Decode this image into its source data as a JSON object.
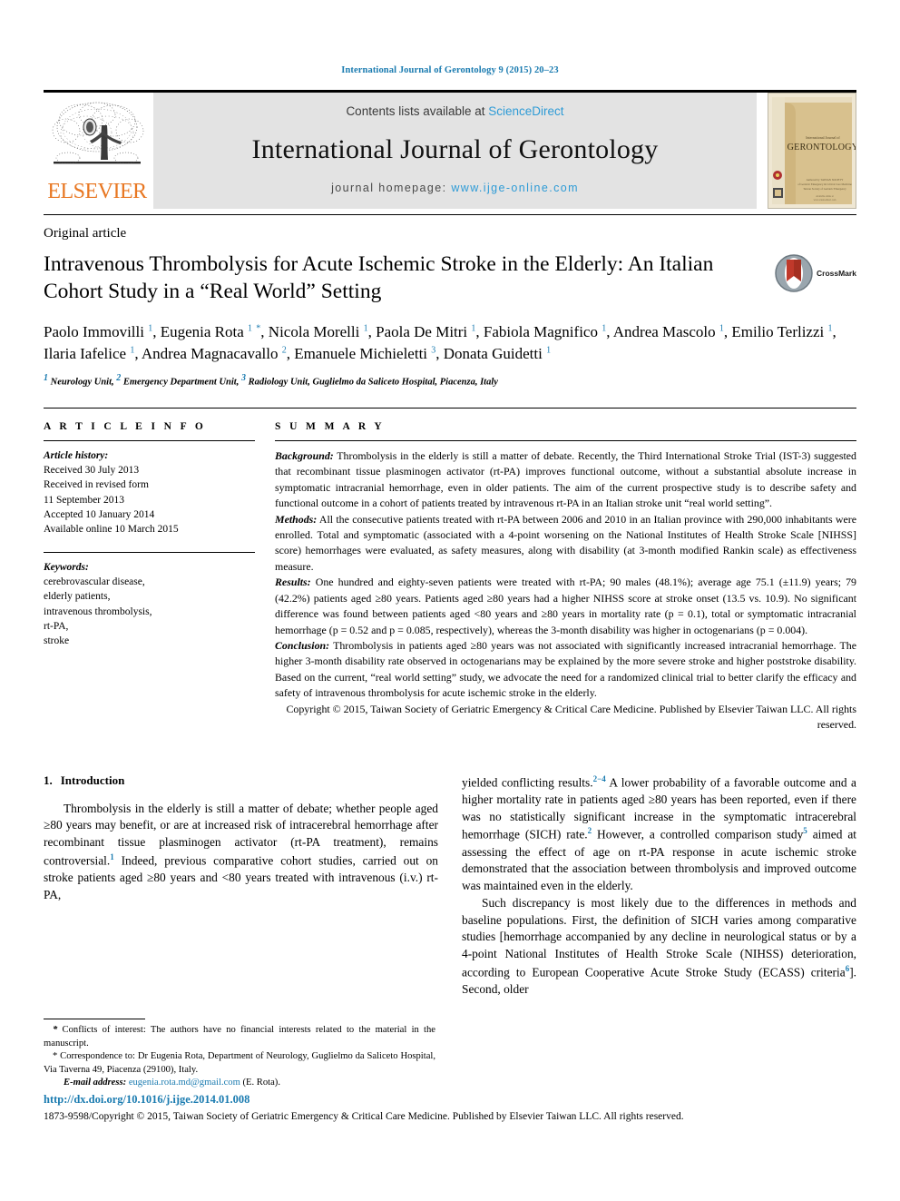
{
  "running_head": "International Journal of Gerontology 9 (2015) 20–23",
  "masthead": {
    "publisher_logo_text": "ELSEVIER",
    "contents_prefix": "Contents lists available at ",
    "contents_link": "ScienceDirect",
    "journal_title": "International Journal of Gerontology",
    "homepage_prefix": "journal homepage: ",
    "homepage_url": "www.ijge-online.com",
    "cover": {
      "small_title": "International Journal of",
      "big_title": "GERONTOLOGY",
      "publisher_note": "Published by ELSEVIER TAIWAN LLC",
      "society_note": "Taiwan Society of Geriatric Emergency & Critical Care Medicine",
      "footer_note": "Available online at",
      "footer_note2": "www.sciencedirect.com"
    }
  },
  "article": {
    "type": "Original article",
    "title": "Intravenous Thrombolysis for Acute Ischemic Stroke in the Elderly: An Italian Cohort Study in a “Real World” Setting",
    "title_footnote_marker": "★",
    "crossmark_label": "CrossMark",
    "authors_html": "Paolo Immovilli <sup>1</sup>, Eugenia Rota <sup>1</sup> <sup class=\"star\">*</sup>, Nicola Morelli <sup>1</sup>, Paola De Mitri <sup>1</sup>, Fabiola Magnifico <sup>1</sup>, Andrea Mascolo <sup>1</sup>, Emilio Terlizzi <sup>1</sup>, Ilaria Iafelice <sup>1</sup>, Andrea Magnacavallo <sup>2</sup>, Emanuele Michieletti <sup>3</sup>, Donata Guidetti <sup>1</sup>",
    "affiliations_html": "<sup>1</sup> Neurology Unit, <sup>2</sup> Emergency Department Unit, <sup>3</sup> Radiology Unit, Guglielmo da Saliceto Hospital, Piacenza, Italy"
  },
  "article_info": {
    "heading": "A R T I C L E  I N F O",
    "history_label": "Article history:",
    "history": [
      "Received 30 July 2013",
      "Received in revised form",
      "11 September 2013",
      "Accepted 10 January 2014",
      "Available online 10 March 2015"
    ],
    "keywords_label": "Keywords:",
    "keywords": [
      "cerebrovascular disease,",
      "elderly patients,",
      "intravenous thrombolysis,",
      "rt-PA,",
      "stroke"
    ]
  },
  "summary": {
    "heading": "S U M M A R Y",
    "background_label": "Background:",
    "background_text": " Thrombolysis in the elderly is still a matter of debate. Recently, the Third International Stroke Trial (IST-3) suggested that recombinant tissue plasminogen activator (rt-PA) improves functional outcome, without a substantial absolute increase in symptomatic intracranial hemorrhage, even in older patients. The aim of the current prospective study is to describe safety and functional outcome in a cohort of patients treated by intravenous rt-PA in an Italian stroke unit “real world setting”.",
    "methods_label": "Methods:",
    "methods_text": " All the consecutive patients treated with rt-PA between 2006 and 2010 in an Italian province with 290,000 inhabitants were enrolled. Total and symptomatic (associated with a 4-point worsening on the National Institutes of Health Stroke Scale [NIHSS] score) hemorrhages were evaluated, as safety measures, along with disability (at 3-month modified Rankin scale) as effectiveness measure.",
    "results_label": "Results:",
    "results_text": " One hundred and eighty-seven patients were treated with rt-PA; 90 males (48.1%); average age 75.1 (±11.9) years; 79 (42.2%) patients aged ≥80 years. Patients aged ≥80 years had a higher NIHSS score at stroke onset (13.5 vs. 10.9). No significant difference was found between patients aged <80 years and ≥80 years in mortality rate (p = 0.1), total or symptomatic intracranial hemorrhage (p = 0.52 and p = 0.085, respectively), whereas the 3-month disability was higher in octogenarians (p = 0.004).",
    "conclusion_label": "Conclusion:",
    "conclusion_text": " Thrombolysis in patients aged ≥80 years was not associated with significantly increased intracranial hemorrhage. The higher 3-month disability rate observed in octogenarians may be explained by the more severe stroke and higher poststroke disability. Based on the current, “real world setting” study, we advocate the need for a randomized clinical trial to better clarify the efficacy and safety of intravenous thrombolysis for acute ischemic stroke in the elderly.",
    "copyright": "Copyright © 2015, Taiwan Society of Geriatric Emergency & Critical Care Medicine. Published by Elsevier Taiwan LLC. All rights reserved."
  },
  "sections": {
    "intro_number": "1.",
    "intro_title": "Introduction",
    "intro_p1_html": "Thrombolysis in the elderly is still a matter of debate; whether people aged ≥80 years may benefit, or are at increased risk of intracerebral hemorrhage after recombinant tissue plasminogen activator (rt-PA treatment), remains controversial.<sup>1</sup> Indeed, previous comparative cohort studies, carried out on stroke patients aged ≥80 years and &lt;80 years treated with intravenous (i.v.) rt-PA,",
    "intro_p2_html": "yielded conflicting results.<sup>2−4</sup> A lower probability of a favorable outcome and a higher mortality rate in patients aged ≥80 years has been reported, even if there was no statistically significant increase in the symptomatic intracerebral hemorrhage (SICH) rate.<sup>2</sup> However, a controlled comparison study<sup>5</sup> aimed at assessing the effect of age on rt-PA response in acute ischemic stroke demonstrated that the association between thrombolysis and improved outcome was maintained even in the elderly.",
    "intro_p3_html": "Such discrepancy is most likely due to the differences in methods and baseline populations. First, the definition of SICH varies among comparative studies [hemorrhage accompanied by any decline in neurological status or by a 4-point National Institutes of Health Stroke Scale (NIHSS) deterioration, according to European Cooperative Acute Stroke Study (ECASS) criteria<sup>6</sup>]. Second, older"
  },
  "footnotes": {
    "conflict_html": "<span class=\"em\">*</span> Conflicts of interest: The authors have no financial interests related to the material in the manuscript.",
    "correspondence_html": "* Correspondence to: Dr Eugenia Rota, Department of Neurology, Guglielmo da Saliceto Hospital, Via Taverna 49, Piacenza (29100), Italy.",
    "email_label": "E-mail address:",
    "email_value": "eugenia.rota.md@gmail.com",
    "email_suffix": "(E. Rota)."
  },
  "page_footer": {
    "doi": "http://dx.doi.org/10.1016/j.ijge.2014.01.008",
    "issn_line": "1873-9598/Copyright © 2015, Taiwan Society of Geriatric Emergency & Critical Care Medicine. Published by Elsevier Taiwan LLC. All rights reserved."
  },
  "colors": {
    "link_blue": "#1a7bb0",
    "sd_blue": "#2e9bd6",
    "elsevier_orange": "#E87722",
    "masthead_gray": "#e3e3e3",
    "cover_tan": "#d8c18e"
  }
}
